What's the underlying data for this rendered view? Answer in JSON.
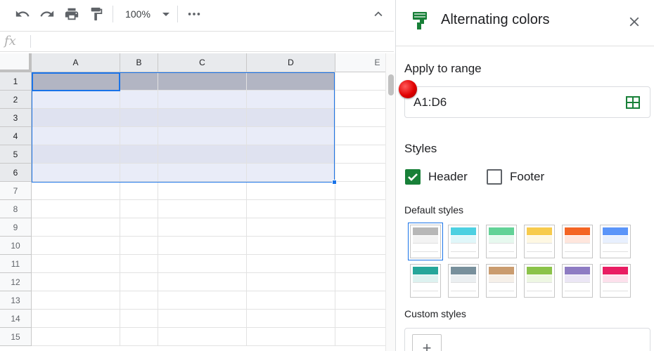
{
  "toolbar": {
    "zoom_value": "100%",
    "undo_icon": "undo-icon",
    "redo_icon": "redo-icon",
    "print_icon": "print-icon",
    "paint_format_icon": "paint-format-icon",
    "more_icon": "more-icon",
    "collapse_icon": "chevron-up-icon"
  },
  "formula_bar": {
    "fx_label": "fx",
    "value": ""
  },
  "grid": {
    "columns": [
      "A",
      "B",
      "C",
      "D",
      "E"
    ],
    "rows": [
      "1",
      "2",
      "3",
      "4",
      "5",
      "6",
      "7",
      "8",
      "9",
      "10",
      "11",
      "12",
      "13",
      "14",
      "15"
    ],
    "selected_columns": [
      "A",
      "B",
      "C",
      "D"
    ],
    "selected_rows": [
      "1",
      "2",
      "3",
      "4",
      "5",
      "6"
    ],
    "colors": {
      "header_fill": "#b2b5c3",
      "band_light": "#e9ecf8",
      "band_dark": "#dfe2f0",
      "selection_border": "#1a73e8"
    }
  },
  "panel": {
    "title": "Alternating colors",
    "icon": "paint-roller-icon",
    "apply_label": "Apply to range",
    "range_value": "A1:D6",
    "styles_label": "Styles",
    "header_label": "Header",
    "header_checked": true,
    "footer_label": "Footer",
    "footer_checked": false,
    "default_styles_label": "Default styles",
    "custom_styles_label": "Custom styles",
    "add_label": "+",
    "swatches": [
      {
        "header": "#b7b7b7",
        "band": "#f3f3f3",
        "selected": true
      },
      {
        "header": "#4dd0e1",
        "band": "#e0f7fa",
        "selected": false
      },
      {
        "header": "#63d297",
        "band": "#e7f9ef",
        "selected": false
      },
      {
        "header": "#f7cb4d",
        "band": "#fef8e3",
        "selected": false
      },
      {
        "header": "#f46524",
        "band": "#ffe6dd",
        "selected": false
      },
      {
        "header": "#5b95f9",
        "band": "#e8f0fe",
        "selected": false
      },
      {
        "header": "#26a69a",
        "band": "#ddf2f0",
        "selected": false
      },
      {
        "header": "#78909c",
        "band": "#ebeff1",
        "selected": false
      },
      {
        "header": "#ca9c6f",
        "band": "#f6f0e9",
        "selected": false
      },
      {
        "header": "#8bc34a",
        "band": "#eef7e3",
        "selected": false
      },
      {
        "header": "#8e7cc3",
        "band": "#ebe6f5",
        "selected": false
      },
      {
        "header": "#e91e63",
        "band": "#fde0ec",
        "selected": false
      }
    ]
  }
}
